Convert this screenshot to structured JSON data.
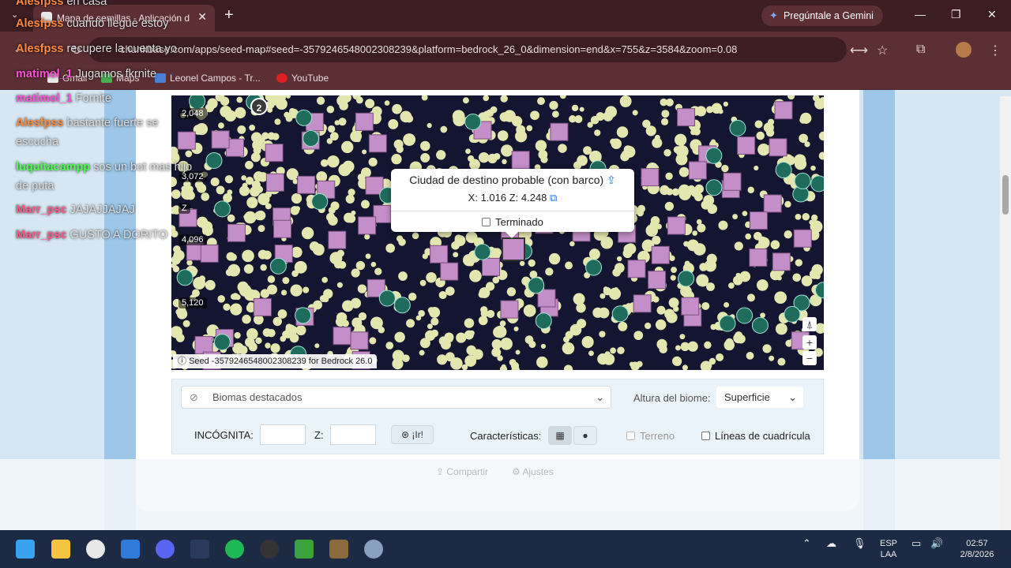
{
  "browser": {
    "tab_title": "Mapa de semillas - Aplicación d",
    "gemini_label": "Pregúntale a Gemini",
    "url": "chunkbase.com/apps/seed-map#seed=-3579246548002308239&platform=bedrock_26_0&dimension=end&x=755&z=3584&zoom=0.08",
    "bookmarks": [
      "Gmail",
      "Maps",
      "Leonel Campos - Tr...",
      "YouTube"
    ]
  },
  "map": {
    "cluster_badge": "2",
    "coord_labels": [
      "2,048",
      "3,072",
      "Z",
      "4,096",
      "5,120"
    ],
    "popup": {
      "title": "Ciudad de destino probable (con barco)",
      "coords": "X: 1.016 Z: 4.248",
      "done_label": "Terminado"
    },
    "seed_text": "Seed -3579246548002308239 for Bedrock 26.0"
  },
  "controls": {
    "biomes_placeholder": "Biomas destacados",
    "biome_height_label": "Altura del biome:",
    "biome_height_value": "Superficie",
    "x_label": "INCÓGNITA:",
    "z_label": "Z:",
    "go_label": "¡Ir!",
    "features_label": "Características:",
    "terrain_label": "Terreno",
    "grid_label": "Líneas de cuadrícula",
    "share_label": "Compartir",
    "settings_label": "Ajustes"
  },
  "chat": [
    {
      "user": "Alesfpss",
      "color": "#ff8a3d",
      "msg": "en casa"
    },
    {
      "user": "Alesfpss",
      "color": "#ff8a3d",
      "msg": "cuando llegue estoy"
    },
    {
      "user": "Alesfpss",
      "color": "#ff8a3d",
      "msg": "recupere la cuenta yo"
    },
    {
      "user": "matimol_1",
      "color": "#ff4fd8",
      "msg": "Jugamos fkrnite"
    },
    {
      "user": "matimol_1",
      "color": "#ff4fd8",
      "msg": "Fornite"
    },
    {
      "user": "Alesfpss",
      "color": "#ff8a3d",
      "msg": "bastante fuerte se"
    },
    {
      "user": "",
      "color": "#ddd",
      "msg": "escucha"
    },
    {
      "user": "luquitacampp",
      "color": "#4cff4c",
      "msg": "sos un bot mas hijo"
    },
    {
      "user": "",
      "color": "#ddd",
      "msg": "de puta"
    },
    {
      "user": "Marr_psc",
      "color": "#ff5a8a",
      "msg": "JAJAJJAJAJ"
    },
    {
      "user": "Marr_psc",
      "color": "#ff5a8a",
      "msg": "GUSTO A DORITO"
    }
  ],
  "taskbar": {
    "lang": "ESP",
    "layout": "LAA",
    "time": "02:57",
    "date": "2/8/2026"
  }
}
